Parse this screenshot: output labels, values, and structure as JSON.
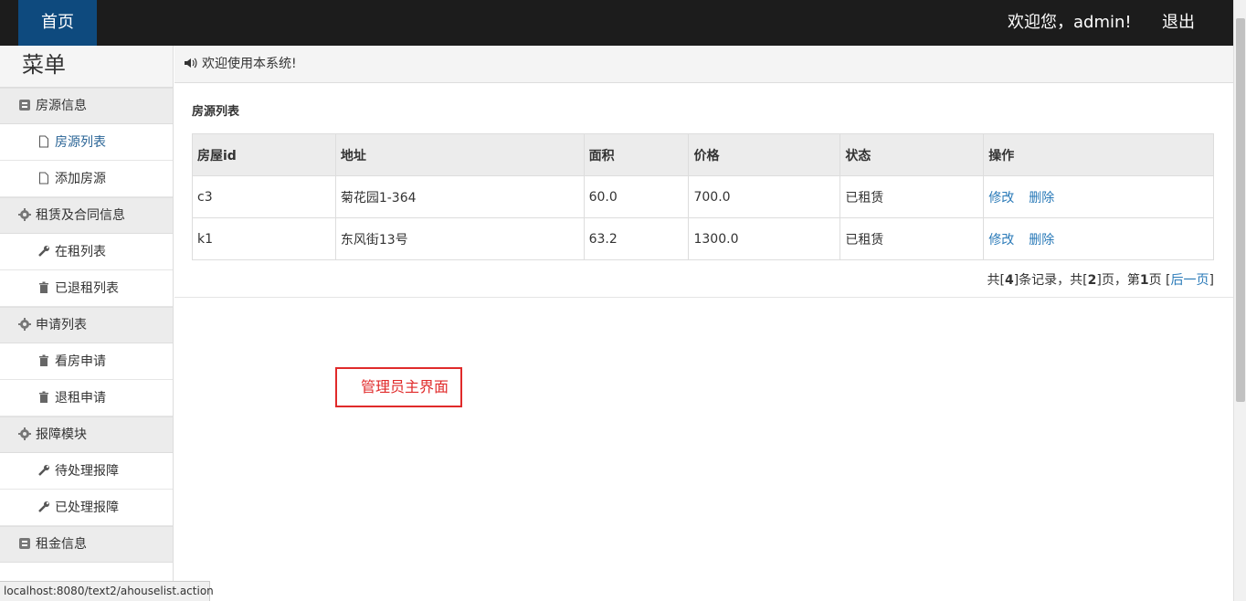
{
  "header": {
    "home": "首页",
    "welcome": "欢迎您，admin!",
    "logout": "退出"
  },
  "sidebar": {
    "title": "菜单",
    "groups": [
      {
        "label": "房源信息",
        "icon": "book-icon",
        "items": [
          {
            "label": "房源列表",
            "icon": "file-icon",
            "active": true
          },
          {
            "label": "添加房源",
            "icon": "file-icon"
          }
        ]
      },
      {
        "label": "租赁及合同信息",
        "icon": "gear-icon",
        "items": [
          {
            "label": "在租列表",
            "icon": "wrench-icon"
          },
          {
            "label": "已退租列表",
            "icon": "trash-icon"
          }
        ]
      },
      {
        "label": "申请列表",
        "icon": "gear-icon",
        "items": [
          {
            "label": "看房申请",
            "icon": "trash-icon"
          },
          {
            "label": "退租申请",
            "icon": "trash-icon"
          }
        ]
      },
      {
        "label": "报障模块",
        "icon": "gear-icon",
        "items": [
          {
            "label": "待处理报障",
            "icon": "wrench-icon"
          },
          {
            "label": "已处理报障",
            "icon": "wrench-icon"
          }
        ]
      },
      {
        "label": "租金信息",
        "icon": "book-icon",
        "items": []
      }
    ]
  },
  "notice": "欢迎使用本系统!",
  "list": {
    "title": "房源列表",
    "columns": [
      "房屋id",
      "地址",
      "面积",
      "价格",
      "状态",
      "操作"
    ],
    "rows": [
      {
        "id": "c3",
        "address": "菊花园1-364",
        "area": "60.0",
        "price": "700.0",
        "status": "已租赁",
        "edit": "修改",
        "delete": "删除"
      },
      {
        "id": "k1",
        "address": "东风街13号",
        "area": "63.2",
        "price": "1300.0",
        "status": "已租赁",
        "edit": "修改",
        "delete": "删除"
      }
    ],
    "pager": {
      "p1": "共[",
      "records": "4",
      "p2": "]条记录，共[",
      "pages": "2",
      "p3": "]页，第",
      "current": "1",
      "p4": "页 [",
      "next": "后一页",
      "p5": "]"
    }
  },
  "annotation": "管理员主界面",
  "status_url": "localhost:8080/text2/ahouselist.action"
}
